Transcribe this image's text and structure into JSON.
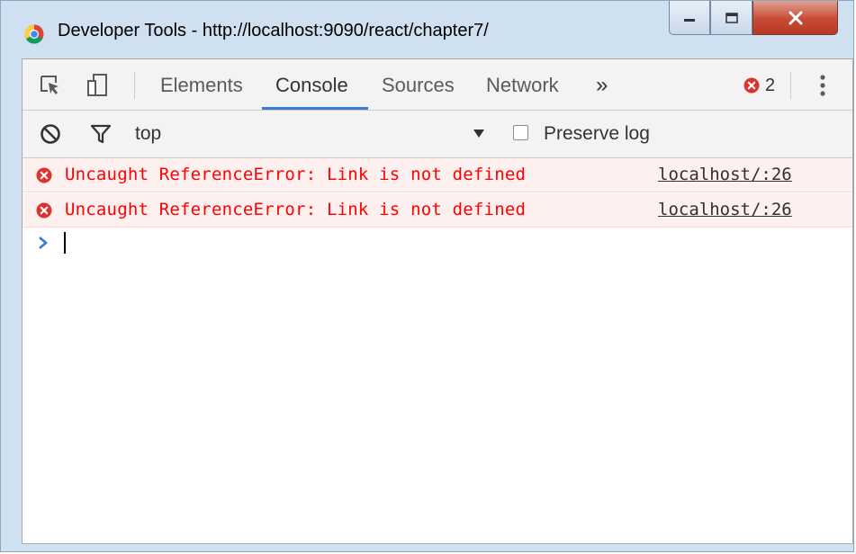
{
  "window": {
    "title": "Developer Tools - http://localhost:9090/react/chapter7/",
    "buttons": {
      "minimize": "minimize",
      "maximize": "maximize",
      "close": "close"
    }
  },
  "toolbar": {
    "tabs": [
      {
        "label": "Elements"
      },
      {
        "label": "Console",
        "active": true
      },
      {
        "label": "Sources"
      },
      {
        "label": "Network"
      }
    ],
    "more_tabs": "»",
    "error_count": "2",
    "icons": [
      "inspect-element-icon",
      "device-toolbar-icon",
      "more-tabs-icon",
      "error-icon",
      "kebab-menu-icon"
    ]
  },
  "filter": {
    "context": "top",
    "preserve_log_label": "Preserve log",
    "preserve_log_checked": false,
    "icons": [
      "clear-console-icon",
      "filter-icon",
      "dropdown-arrow-icon"
    ]
  },
  "console": {
    "messages": [
      {
        "text": "Uncaught ReferenceError: Link is not defined",
        "source": "localhost/:26",
        "level": "error"
      },
      {
        "text": "Uncaught ReferenceError: Link is not defined",
        "source": "localhost/:26",
        "level": "error"
      }
    ]
  },
  "colors": {
    "error_text": "#ff0000",
    "error_bg": "#fff0f0",
    "active_tab_underline": "#3879d9",
    "prompt_chevron": "#3879d9",
    "titlebar_bg": "#cfe0f1",
    "close_button": "#c84a35"
  }
}
